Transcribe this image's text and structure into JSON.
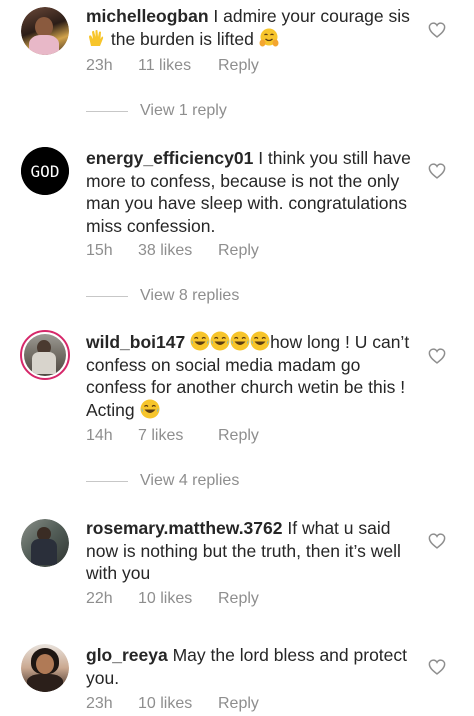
{
  "comments": [
    {
      "username": "michelleogban",
      "text_a": " I admire your courage sis",
      "text_b": " the burden is lifted",
      "time": "23h",
      "likes": "11 likes",
      "reply": "Reply",
      "view_replies": "View 1 reply"
    },
    {
      "username": "energy_efficiency01",
      "text": " I think you still have more to confess, because is not the only  man you have sleep with. congratulations miss confession.",
      "avatar_text": "GOD",
      "time": "15h",
      "likes": "38 likes",
      "reply": "Reply",
      "view_replies": "View 8 replies"
    },
    {
      "username": "wild_boi147",
      "text_a": "how long ! U can’t confess on social media madam go confess for another church wetin be this ! Acting",
      "time": "14h",
      "likes": "7 likes",
      "reply": "Reply",
      "view_replies": "View 4 replies"
    },
    {
      "username": "rosemary.matthew.3762",
      "text": " If what u said now is nothing but the truth, then it’s well with you",
      "time": "22h",
      "likes": "10 likes",
      "reply": "Reply"
    },
    {
      "username": "glo_reeya",
      "text": " May the lord bless and protect you.",
      "time": "23h",
      "likes": "10 likes",
      "reply": "Reply"
    }
  ],
  "icons": {
    "like": "heart-outline-icon",
    "clap": "clapping-hands-emoji",
    "hug": "hugging-face-emoji",
    "laugh": "tears-of-joy-emoji"
  },
  "colors": {
    "text": "#262626",
    "meta": "#8e8e8e",
    "story_ring": "#d6286a"
  }
}
